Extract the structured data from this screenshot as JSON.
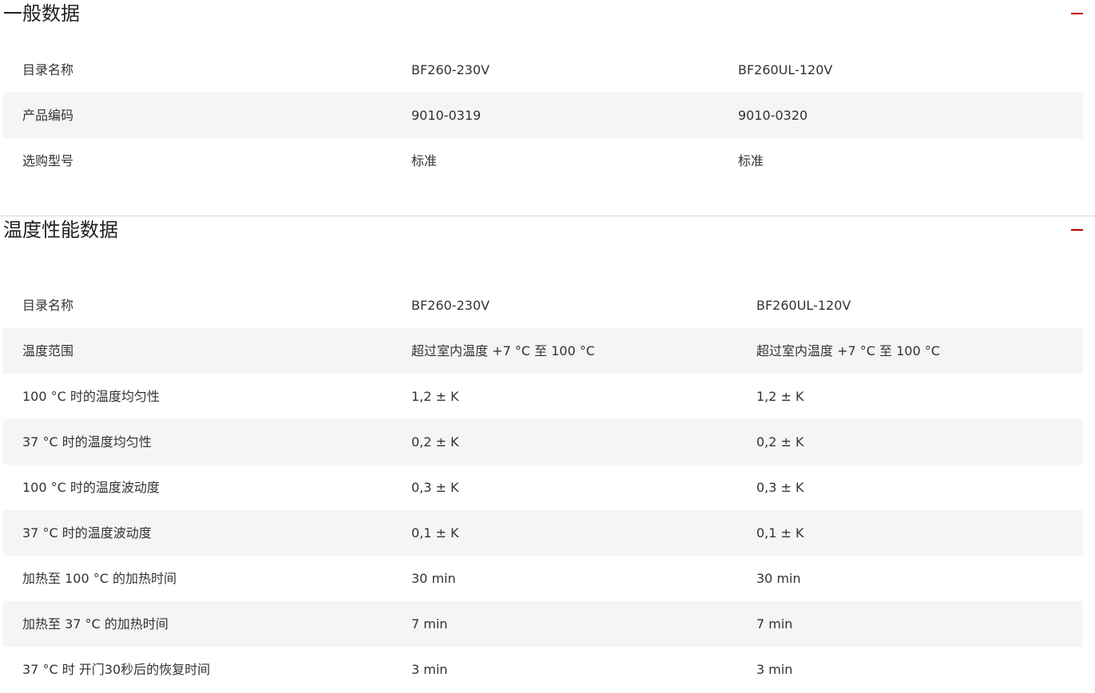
{
  "colors": {
    "accent": "#c00000",
    "row_alt": "#f4f5f7",
    "divider": "#d6d6d6"
  },
  "icons": {
    "collapse": "minus-icon"
  },
  "sections": [
    {
      "title": "一般数据",
      "rows": [
        [
          "目录名称",
          "BF260-230V",
          "BF260UL-120V"
        ],
        [
          "产品编码",
          "9010-0319",
          "9010-0320"
        ],
        [
          "选购型号",
          "标准",
          "标准"
        ]
      ]
    },
    {
      "title": "温度性能数据",
      "rows": [
        [
          "目录名称",
          "BF260-230V",
          "BF260UL-120V"
        ],
        [
          "温度范围",
          "超过室内温度 +7 °C 至 100 °C",
          "超过室内温度 +7 °C 至 100 °C"
        ],
        [
          "100 °C 时的温度均匀性",
          "1,2 ± K",
          "1,2 ± K"
        ],
        [
          "37 °C 时的温度均匀性",
          "0,2 ± K",
          "0,2 ± K"
        ],
        [
          "100 °C 时的温度波动度",
          "0,3 ± K",
          "0,3 ± K"
        ],
        [
          "37 °C 时的温度波动度",
          "0,1 ± K",
          "0,1 ± K"
        ],
        [
          "加热至 100 °C 的加热时间",
          "30 min",
          "30 min"
        ],
        [
          "加热至 37 °C 的加热时间",
          "7 min",
          "7 min"
        ],
        [
          "37 °C 时 开门30秒后的恢复时间",
          "3 min",
          "3 min"
        ]
      ]
    }
  ]
}
